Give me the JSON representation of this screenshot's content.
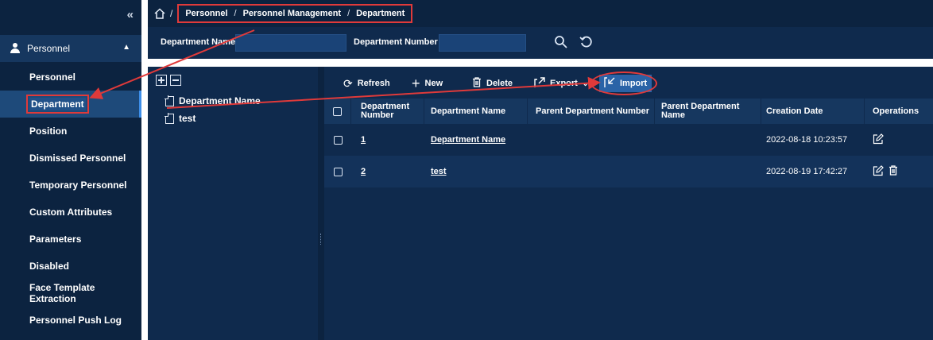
{
  "sidebar": {
    "collapse_glyph": "«",
    "module": {
      "label": "Personnel",
      "icon": "user-icon"
    },
    "items": [
      {
        "label": "Personnel"
      },
      {
        "label": "Department"
      },
      {
        "label": "Position"
      },
      {
        "label": "Dismissed Personnel"
      },
      {
        "label": "Temporary Personnel"
      },
      {
        "label": "Custom Attributes"
      },
      {
        "label": "Parameters"
      },
      {
        "label": "Disabled"
      },
      {
        "label": "Face Template Extraction"
      },
      {
        "label": "Personnel Push Log"
      }
    ]
  },
  "breadcrumb": {
    "root_sep": "/",
    "items": [
      "Personnel",
      "Personnel Management",
      "Department"
    ],
    "sep": "/"
  },
  "search": {
    "name_label": "Department Name",
    "name_value": "",
    "number_label": "Department Number",
    "number_value": ""
  },
  "tree": {
    "nodes": [
      "Department Name",
      "test"
    ]
  },
  "toolbar": {
    "refresh": "Refresh",
    "new": "New",
    "delete": "Delete",
    "export": "Export",
    "import": "Import"
  },
  "table": {
    "headers": {
      "number": "Department Number",
      "name": "Department Name",
      "parent_number": "Parent Department Number",
      "parent_name": "Parent Department Name",
      "creation_date": "Creation Date",
      "operations": "Operations"
    },
    "rows": [
      {
        "number": "1",
        "name": "Department Name",
        "parent_number": "",
        "parent_name": "",
        "creation_date": "2022-08-18 10:23:57"
      },
      {
        "number": "2",
        "name": "test",
        "parent_number": "",
        "parent_name": "",
        "creation_date": "2022-08-19 17:42:27"
      }
    ]
  },
  "colors": {
    "sidebar_bg": "#0c2340",
    "panel_bg": "#0f2a4d",
    "active_item": "#1e4a7a",
    "import_button": "#2a63a7",
    "annotation_red": "#e03a3a"
  }
}
